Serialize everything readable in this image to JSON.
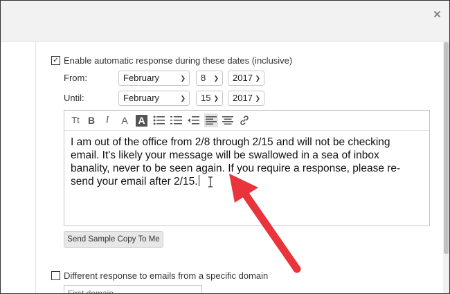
{
  "dialog": {
    "close_glyph": "×"
  },
  "auto_response": {
    "checkbox_checked": true,
    "label": "Enable automatic response during these dates (inclusive)",
    "from": {
      "label": "From:",
      "month": "February",
      "day": "8",
      "year": "2017"
    },
    "until": {
      "label": "Until:",
      "month": "February",
      "day": "15",
      "year": "2017"
    }
  },
  "editor": {
    "toolbar": [
      {
        "name": "text-size-icon",
        "glyph": "Tt"
      },
      {
        "name": "bold-icon",
        "glyph": "B"
      },
      {
        "name": "italic-icon",
        "glyph": "I"
      },
      {
        "name": "font-color-icon",
        "glyph": "A"
      },
      {
        "name": "highlight-icon",
        "glyph": "A"
      },
      {
        "name": "bullet-list-icon",
        "glyph": "☰"
      },
      {
        "name": "numbered-list-icon",
        "glyph": "☰"
      },
      {
        "name": "outdent-icon",
        "glyph": "☰"
      },
      {
        "name": "align-left-icon",
        "glyph": "☰"
      },
      {
        "name": "align-center-icon",
        "glyph": "☰"
      },
      {
        "name": "link-icon",
        "glyph": "🔗"
      }
    ],
    "body_lines": [
      "I am out of the office from 2/8 through 2/15 and will not be checking",
      "email. It's likely your message will be swallowed in a sea of inbox",
      "banality, never to be seen again. If you require a response, please re-",
      "send your email after 2/15."
    ]
  },
  "send_sample_button": "Send Sample Copy To Me",
  "domain_response": {
    "checkbox_checked": false,
    "label": "Different response to emails from a specific domain",
    "input_placeholder": "First domain"
  },
  "annotation_color": "#e8343a"
}
